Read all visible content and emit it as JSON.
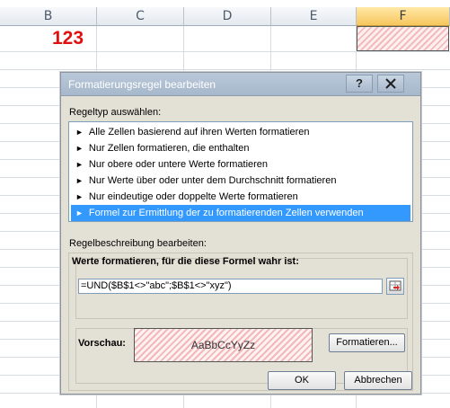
{
  "sheet": {
    "columns": [
      "B",
      "C",
      "D",
      "E",
      "F"
    ],
    "selected_column": "F",
    "cell_value": "123"
  },
  "dialog": {
    "title": "Formatierungsregel bearbeiten",
    "help_label": "?",
    "close_label": "X",
    "ruletype_label": "Regeltyp auswählen:",
    "rule_types": [
      "Alle Zellen basierend auf ihren Werten formatieren",
      "Nur Zellen formatieren, die enthalten",
      "Nur obere oder untere Werte formatieren",
      "Nur Werte über oder unter dem Durchschnitt formatieren",
      "Nur eindeutige oder doppelte Werte formatieren",
      "Formel zur Ermittlung der zu formatierenden Zellen verwenden"
    ],
    "selected_rule_index": 5,
    "description_label": "Regelbeschreibung bearbeiten:",
    "formula_label": "Werte formatieren, für die diese Formel wahr ist:",
    "formula_value": "=UND($B$1<>\"abc\";$B$1<>\"xyz\")",
    "preview_label": "Vorschau:",
    "preview_text": "AaBbCcYyZz",
    "format_button": "Formatieren...",
    "ok_button": "OK",
    "cancel_button": "Abbrechen"
  },
  "colors": {
    "accent_selected": "#3399ff",
    "cell_text_red": "#e0100f",
    "hatch": "#f3b8b8"
  }
}
